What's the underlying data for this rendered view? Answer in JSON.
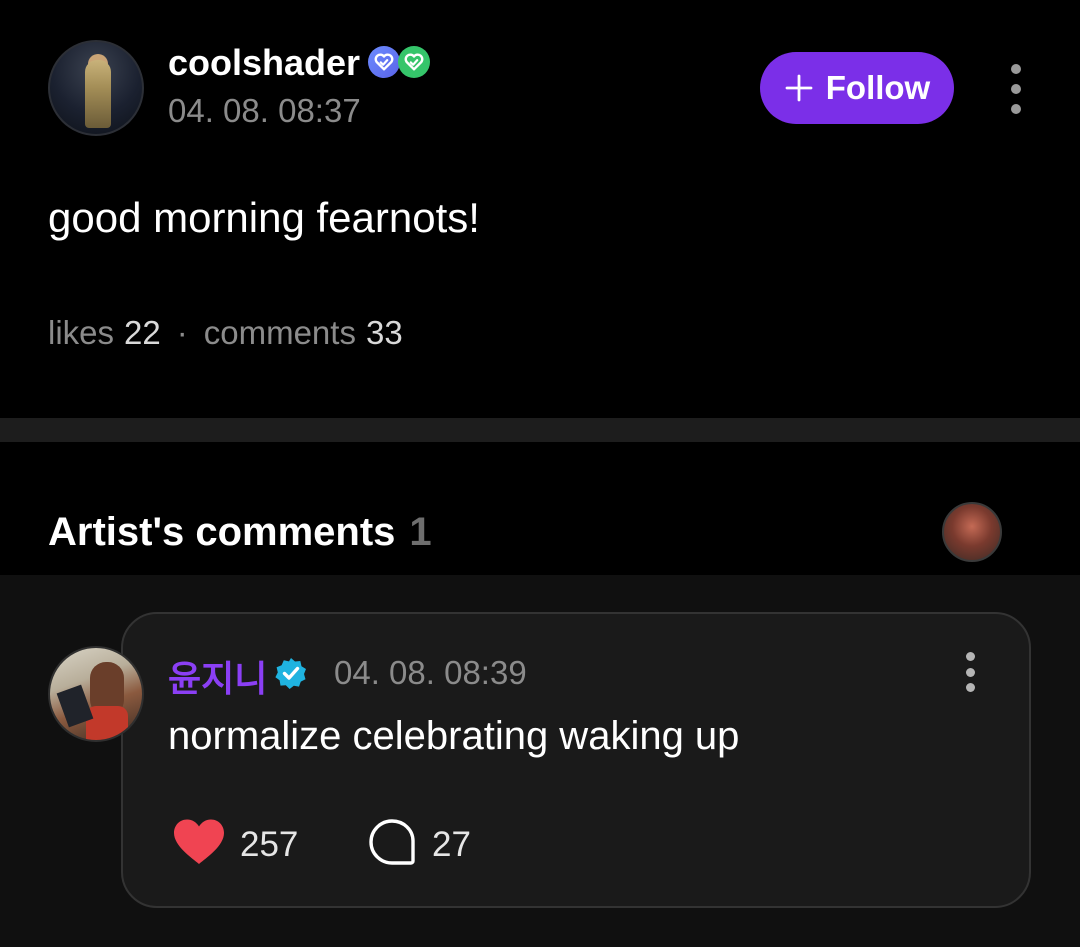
{
  "post": {
    "username": "coolshader",
    "time": "04. 08. 08:37",
    "follow_label": "Follow",
    "body": "good morning fearnots!",
    "likes_label": "likes",
    "likes_count": "22",
    "separator": "·",
    "comments_label": "comments",
    "comments_count": "33"
  },
  "artist_comments": {
    "title": "Artist's comments",
    "count": "1"
  },
  "comment": {
    "author": "윤지니",
    "time": "04. 08. 08:39",
    "text": "normalize celebrating waking up",
    "likes": "257",
    "replies": "27"
  },
  "colors": {
    "accent": "#7b2fe8",
    "author_name": "#8b3ff5",
    "heart": "#f04452",
    "verified_badge": "#1fb3e0"
  },
  "icons": [
    "plus-icon",
    "more-vertical-icon",
    "heart-icon",
    "speech-bubble-icon",
    "verified-icon",
    "fan-badge-icon",
    "heart-check-badge-icon"
  ]
}
